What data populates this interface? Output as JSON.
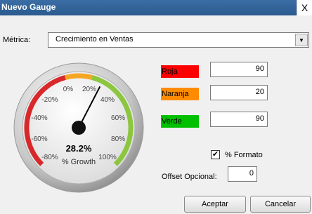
{
  "window": {
    "title": "Nuevo Gauge",
    "close": "X"
  },
  "metrica": {
    "label": "Métrica:",
    "value": "Crecimiento en Ventas",
    "dropdown_icon": "chevron-down-icon"
  },
  "thresholds": {
    "roja": {
      "label": "Roja",
      "color": "#ff0000",
      "value": "90"
    },
    "naranja": {
      "label": "Naranja",
      "color": "#ff8c00",
      "value": "20"
    },
    "verde": {
      "label": "Verde",
      "color": "#00c000",
      "value": "90"
    }
  },
  "formato": {
    "label": "% Formato",
    "checked": "✔"
  },
  "offset": {
    "label": "Offset Opcional:",
    "value": "0"
  },
  "buttons": {
    "aceptar": "Aceptar",
    "cancelar": "Cancelar"
  },
  "gauge": {
    "value": "28.2%",
    "caption": "% Growth",
    "ticks": [
      "-80%",
      "-60%",
      "-40%",
      "-20%",
      "0%",
      "20%",
      "40%",
      "60%",
      "80%",
      "100%"
    ],
    "colors": {
      "red": "#d9282a",
      "orange": "#f5a623",
      "green": "#8cc63f"
    }
  }
}
